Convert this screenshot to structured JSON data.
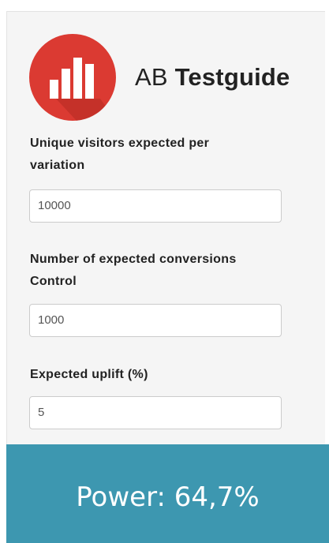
{
  "brand": {
    "prefix": "AB",
    "name": "Testguide",
    "logo_color": "#db3a32"
  },
  "form": {
    "visitors": {
      "label_line1": "Unique visitors expected per",
      "label_line2": "variation",
      "value": "10000"
    },
    "conversions": {
      "label_line1": "Number of expected conversions",
      "label_line2": "Control",
      "value": "1000"
    },
    "uplift": {
      "label": "Expected uplift (%)",
      "value": "5"
    }
  },
  "result": {
    "text": "Power: 64,7%",
    "color": "#3d97b0"
  }
}
